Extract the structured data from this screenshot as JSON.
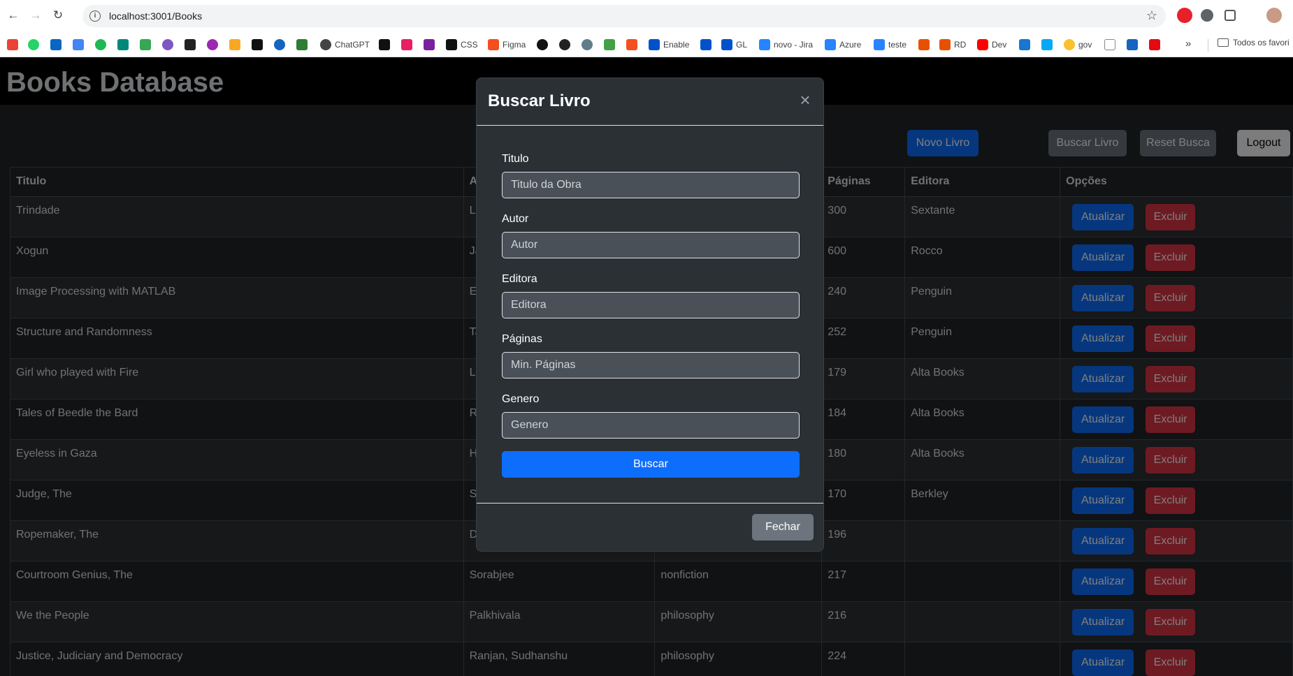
{
  "browser": {
    "url": "localhost:3001/Books",
    "bookmarks": [
      "ChatGPT",
      "CSS",
      "Figma",
      "Enable",
      "GL",
      "novo - Jira",
      "Azure",
      "teste",
      "RD",
      "Dev",
      "gov"
    ],
    "folder_label": "Todos os favori"
  },
  "page": {
    "title": "Books Database",
    "buttons": {
      "new": "Novo Livro",
      "search": "Buscar Livro",
      "reset": "Reset Busca",
      "logout": "Logout"
    }
  },
  "table": {
    "headers": [
      "Titulo",
      "A",
      "",
      "Páginas",
      "Editora",
      "Opções"
    ],
    "rows": [
      {
        "titulo": "Trindade",
        "autor": "Le",
        "genero": "",
        "paginas": "300",
        "editora": "Sextante"
      },
      {
        "titulo": "Xogun",
        "autor": "Ja",
        "genero": "",
        "paginas": "600",
        "editora": "Rocco"
      },
      {
        "titulo": "Image Processing with MATLAB",
        "autor": "Es",
        "genero": "",
        "paginas": "240",
        "editora": "Penguin"
      },
      {
        "titulo": "Structure and Randomness",
        "autor": "Ta",
        "genero": "",
        "paginas": "252",
        "editora": "Penguin"
      },
      {
        "titulo": "Girl who played with Fire",
        "autor": "La",
        "genero": "",
        "paginas": "179",
        "editora": "Alta Books"
      },
      {
        "titulo": "Tales of Beedle the Bard",
        "autor": "Ro",
        "genero": "",
        "paginas": "184",
        "editora": "Alta Books"
      },
      {
        "titulo": "Eyeless in Gaza",
        "autor": "Hu",
        "genero": "",
        "paginas": "180",
        "editora": "Alta Books"
      },
      {
        "titulo": "Judge, The",
        "autor": "St",
        "genero": "",
        "paginas": "170",
        "editora": "Berkley"
      },
      {
        "titulo": "Ropemaker, The",
        "autor": "Di",
        "genero": "",
        "paginas": "196",
        "editora": ""
      },
      {
        "titulo": "Courtroom Genius, The",
        "autor": "Sorabjee",
        "genero": "nonfiction",
        "paginas": "217",
        "editora": ""
      },
      {
        "titulo": "We the People",
        "autor": "Palkhivala",
        "genero": "philosophy",
        "paginas": "216",
        "editora": ""
      },
      {
        "titulo": "Justice, Judiciary and Democracy",
        "autor": "Ranjan, Sudhanshu",
        "genero": "philosophy",
        "paginas": "224",
        "editora": ""
      }
    ],
    "update_label": "Atualizar",
    "delete_label": "Excluir"
  },
  "modal": {
    "title": "Buscar Livro",
    "close_icon": "close-icon",
    "fields": [
      {
        "label": "Titulo",
        "placeholder": "Titulo da Obra"
      },
      {
        "label": "Autor",
        "placeholder": "Autor"
      },
      {
        "label": "Editora",
        "placeholder": "Editora"
      },
      {
        "label": "Páginas",
        "placeholder": "Min. Páginas"
      },
      {
        "label": "Genero",
        "placeholder": "Genero"
      }
    ],
    "submit_label": "Buscar",
    "close_label": "Fechar"
  },
  "colors": {
    "primary": "#0d6efd",
    "danger": "#dc3545",
    "secondary": "#6c757d",
    "background": "#212529",
    "header": "#000000"
  }
}
